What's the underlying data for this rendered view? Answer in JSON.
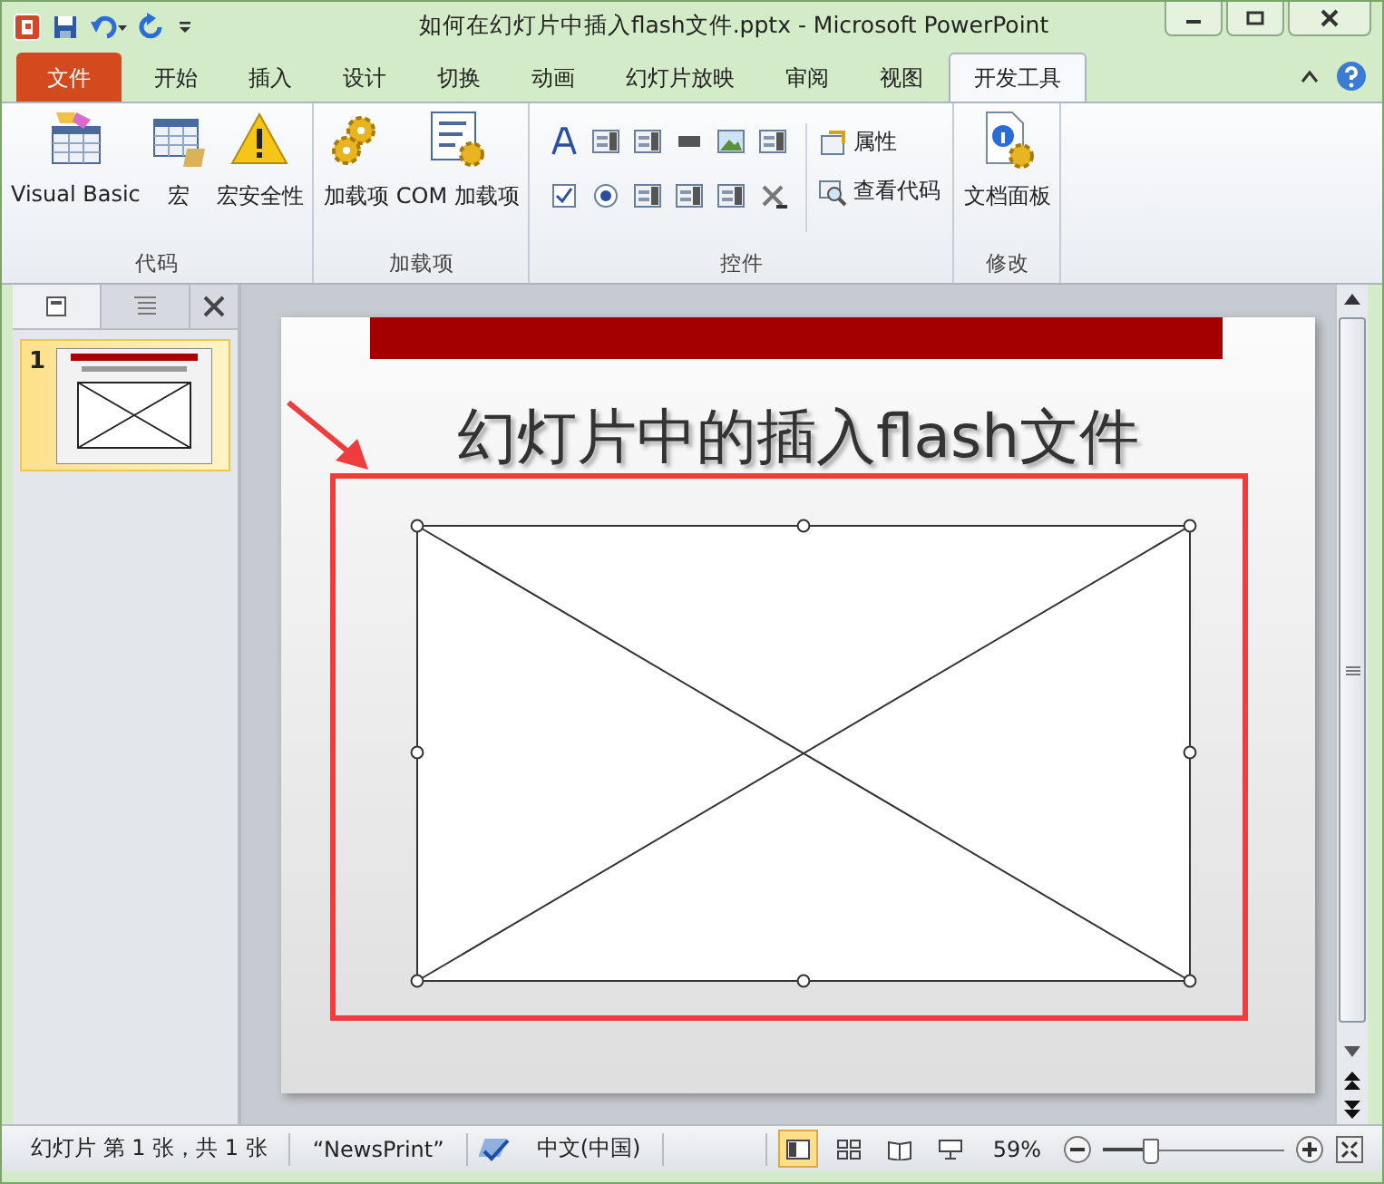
{
  "window": {
    "title": "如何在幻灯片中插入flash文件.pptx - Microsoft PowerPoint"
  },
  "tabs": [
    {
      "label": "文件",
      "kind": "file",
      "selected": false
    },
    {
      "label": "开始",
      "kind": "tab",
      "selected": false
    },
    {
      "label": "插入",
      "kind": "tab",
      "selected": false
    },
    {
      "label": "设计",
      "kind": "tab",
      "selected": false
    },
    {
      "label": "切换",
      "kind": "tab",
      "selected": false
    },
    {
      "label": "动画",
      "kind": "tab",
      "selected": false
    },
    {
      "label": "幻灯片放映",
      "kind": "tab",
      "selected": false
    },
    {
      "label": "审阅",
      "kind": "tab",
      "selected": false
    },
    {
      "label": "视图",
      "kind": "tab",
      "selected": false
    },
    {
      "label": "开发工具",
      "kind": "tab",
      "selected": true
    }
  ],
  "ribbon_groups": [
    {
      "label": "代码",
      "items": [
        {
          "label": "Visual Basic",
          "kind": "vba"
        },
        {
          "label": "宏",
          "kind": "macro"
        },
        {
          "label": "宏安全性",
          "kind": "security"
        }
      ]
    },
    {
      "label": "加载项",
      "items": [
        {
          "label": "加载项",
          "kind": "addin"
        },
        {
          "label": "COM 加载项",
          "kind": "com"
        }
      ]
    },
    {
      "label": "控件",
      "kind": "controls",
      "items": [
        {
          "label": "属性",
          "kind": "properties"
        },
        {
          "label": "查看代码",
          "kind": "code"
        }
      ]
    },
    {
      "label": "修改",
      "items": [
        {
          "label": "文档面板",
          "kind": "doc"
        }
      ]
    }
  ],
  "slides": [
    {
      "number": "1",
      "selected": true
    }
  ],
  "slide": {
    "title": "幻灯片中的插入flash文件"
  },
  "status_bar": {
    "slide_info": "幻灯片 第 1 张，共 1 张",
    "theme": "“NewsPrint”",
    "language": "中文(中国)",
    "views": [
      {
        "kind": "normal",
        "selected": true
      },
      {
        "kind": "sorter",
        "selected": false
      },
      {
        "kind": "reading",
        "selected": false
      },
      {
        "kind": "show",
        "selected": false
      }
    ],
    "zoom": "59%",
    "zoom_slider": {
      "level": 0.25
    }
  }
}
